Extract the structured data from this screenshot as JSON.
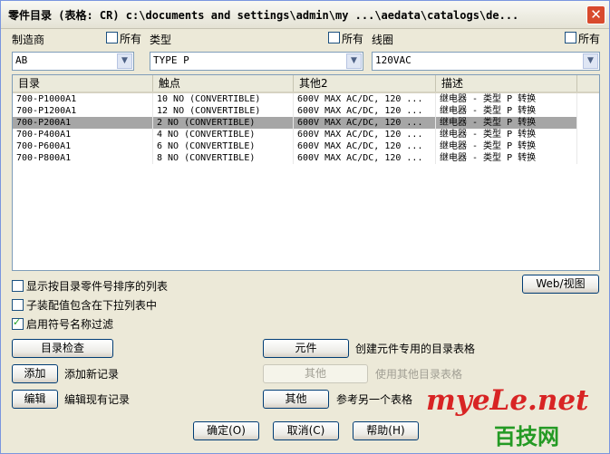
{
  "window": {
    "title": "零件目录 (表格: CR) c:\\documents and settings\\admin\\my ...\\aedata\\catalogs\\de...",
    "close_glyph": "✕"
  },
  "filters": {
    "manufacturer_label": "制造商",
    "type_label": "类型",
    "coil_label": "线圈",
    "all_label": "所有",
    "manufacturer_value": "AB",
    "type_value": "TYPE P",
    "coil_value": "120VAC"
  },
  "table": {
    "columns": [
      "目录",
      "触点",
      "其他2",
      "描述"
    ],
    "rows": [
      [
        "700-P1000A1",
        "10 NO (CONVERTIBLE)",
        "600V MAX AC/DC, 120 ...",
        "继电器 - 类型 P 转换"
      ],
      [
        "700-P1200A1",
        "12 NO (CONVERTIBLE)",
        "600V MAX AC/DC, 120 ...",
        "继电器 - 类型 P 转换"
      ],
      [
        "700-P200A1",
        "2 NO (CONVERTIBLE)",
        "600V MAX AC/DC, 120 ...",
        "继电器 - 类型 P 转换"
      ],
      [
        "700-P400A1",
        "4 NO (CONVERTIBLE)",
        "600V MAX AC/DC, 120 ...",
        "继电器 - 类型 P 转换"
      ],
      [
        "700-P600A1",
        "6 NO (CONVERTIBLE)",
        "600V MAX AC/DC, 120 ...",
        "继电器 - 类型 P 转换"
      ],
      [
        "700-P800A1",
        "8 NO (CONVERTIBLE)",
        "600V MAX AC/DC, 120 ...",
        "继电器 - 类型 P 转换"
      ]
    ],
    "selected_row": 2
  },
  "options": {
    "sort_list_label": "显示按目录零件号排序的列表",
    "include_assembly_label": "子装配值包含在下拉列表中",
    "symbol_filter_label": "启用符号名称过滤",
    "symbol_filter_checked": true
  },
  "buttons": {
    "web_view": "Web/视图",
    "catalog_check": "目录检查",
    "component": "元件",
    "add": "添加",
    "other_disabled": "其他",
    "edit": "编辑",
    "other": "其他",
    "ok": "确定(O)",
    "cancel": "取消(C)",
    "help": "帮助(H)"
  },
  "descriptions": {
    "component": "创建元件专用的目录表格",
    "add": "添加新记录",
    "other_disabled": "使用其他目录表格",
    "edit": "编辑现有记录",
    "other": "参考另一个表格"
  },
  "watermark": {
    "line1": "myeLe.net",
    "line2": "百技网"
  },
  "colors": {
    "dialog_bg": "#ece9d8",
    "selected_row": "#a6a6a6",
    "watermark_red": "#d82424",
    "watermark_green": "#249a24"
  }
}
